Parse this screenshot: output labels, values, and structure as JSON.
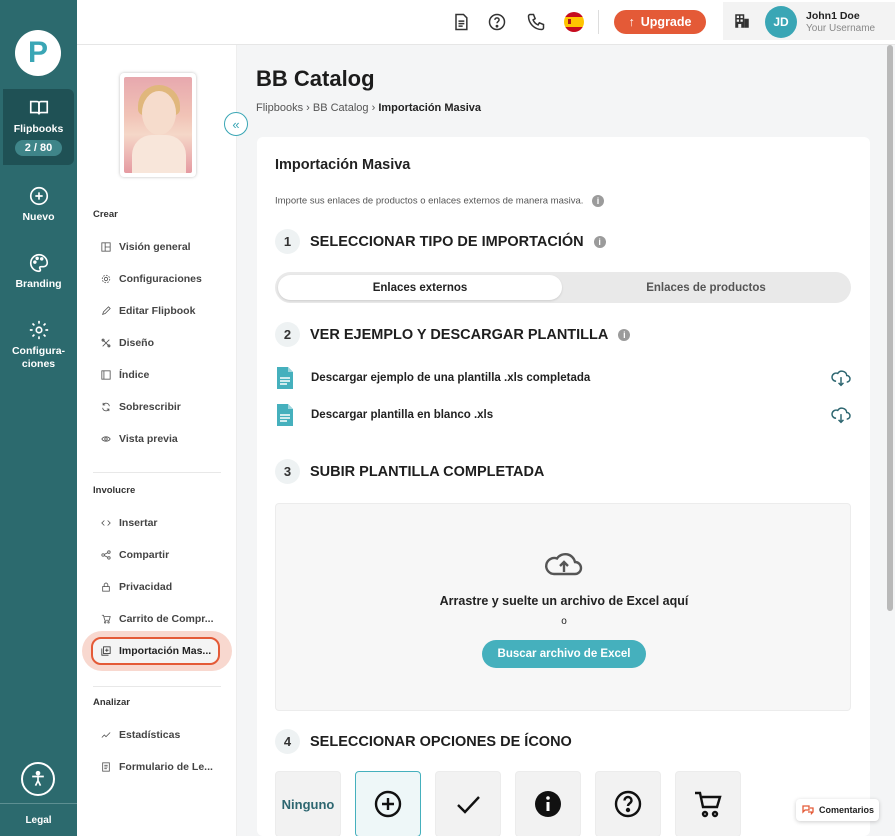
{
  "rail": {
    "logo_letter": "P",
    "items": [
      {
        "label": "Flipbooks",
        "icon": "book-icon"
      },
      {
        "label": "Nuevo",
        "icon": "plus-circle-icon"
      },
      {
        "label": "Branding",
        "icon": "palette-icon"
      },
      {
        "label": "Configura-ciones",
        "icon": "gear-icon"
      }
    ],
    "flipbooks_count": "2 / 80",
    "legal": "Legal"
  },
  "topbar": {
    "upgrade_label": "Upgrade",
    "user_initials": "JD",
    "user_name": "John1 Doe",
    "user_sub": "Your Username"
  },
  "sidebar": {
    "sections": [
      {
        "label": "Crear",
        "items": [
          "Visión general",
          "Configuraciones",
          "Editar Flipbook",
          "Diseño",
          "Índice",
          "Sobrescribir",
          "Vista previa"
        ]
      },
      {
        "label": "Involucre",
        "items": [
          "Insertar",
          "Compartir",
          "Privacidad",
          "Carrito de Compr...",
          "Importación Mas..."
        ]
      },
      {
        "label": "Analizar",
        "items": [
          "Estadísticas",
          "Formulario de Le..."
        ]
      }
    ],
    "active_item": "Importación Mas..."
  },
  "page": {
    "title": "BB Catalog",
    "breadcrumb": [
      "Flipbooks",
      "BB Catalog",
      "Importación Masiva"
    ]
  },
  "card": {
    "title": "Importación Masiva",
    "description": "Importe sus enlaces de productos o enlaces externos de manera masiva.",
    "steps": [
      {
        "num": "1",
        "label": "SELECCIONAR TIPO DE IMPORTACIÓN"
      },
      {
        "num": "2",
        "label": "VER EJEMPLO Y DESCARGAR PLANTILLA"
      },
      {
        "num": "3",
        "label": "SUBIR PLANTILLA COMPLETADA"
      },
      {
        "num": "4",
        "label": "SELECCIONAR OPCIONES DE ÍCONO"
      }
    ],
    "toggle": {
      "selected": "Enlaces externos",
      "other": "Enlaces de productos"
    },
    "downloads": [
      "Descargar ejemplo de una plantilla .xls completada",
      "Descargar plantilla en blanco .xls"
    ],
    "drop": {
      "text": "Arrastre y suelte un archivo de Excel aquí",
      "or": "o",
      "button": "Buscar archivo de Excel"
    },
    "icon_options": [
      "Ninguno",
      "plus-circle-icon",
      "check-icon",
      "info-icon",
      "question-icon",
      "cart-icon"
    ]
  },
  "comments_label": "Comentarios",
  "colors": {
    "rail": "#2c6a6e",
    "accent": "#45b0bd",
    "upgrade": "#e45a37"
  }
}
